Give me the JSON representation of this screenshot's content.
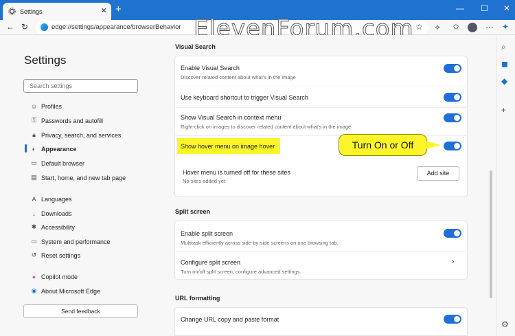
{
  "browser": {
    "tab_title": "Settings",
    "url": "edge://settings/appearance/browserBehavior",
    "watermark": "ElevenForum.com"
  },
  "nav": {
    "title": "Settings",
    "search_placeholder": "Search settings",
    "items": [
      {
        "label": "Profiles",
        "icon": "profile-icon"
      },
      {
        "label": "Passwords and autofill",
        "icon": "key-icon"
      },
      {
        "label": "Privacy, search, and services",
        "icon": "lock-icon"
      },
      {
        "label": "Appearance",
        "icon": "appearance-icon",
        "active": true
      },
      {
        "label": "Default browser",
        "icon": "browser-icon"
      },
      {
        "label": "Start, home, and new tab page",
        "icon": "home-icon"
      },
      {
        "label": "Languages",
        "icon": "language-icon"
      },
      {
        "label": "Downloads",
        "icon": "download-icon"
      },
      {
        "label": "Accessibility",
        "icon": "accessibility-icon"
      },
      {
        "label": "System and performance",
        "icon": "system-icon"
      },
      {
        "label": "Reset settings",
        "icon": "reset-icon"
      },
      {
        "label": "Copilot mode",
        "icon": "copilot-icon"
      },
      {
        "label": "About Microsoft Edge",
        "icon": "edge-icon"
      }
    ],
    "feedback": "Send feedback"
  },
  "visual_search": {
    "title": "Visual Search",
    "enable_title": "Enable Visual Search",
    "enable_sub": "Discover related content about what's in the image",
    "shortcut_title": "Use keyboard shortcut to trigger Visual Search",
    "context_title": "Show Visual Search in context menu",
    "context_sub": "Right-click on images to discover related content about what's in the image",
    "hover_title": "Show hover menu on image hover",
    "hover_off_title": "Hover menu is turned off for these sites",
    "hover_off_sub": "No sites added yet",
    "add_site": "Add site"
  },
  "split_screen": {
    "title": "Split screen",
    "enable_title": "Enable split screen",
    "enable_sub": "Multitask efficiently across side-by-side screens on one browsing tab.",
    "configure_title": "Configure split screen",
    "configure_sub": "Turn on/off split screen, configure advanced settings."
  },
  "url_formatting": {
    "title": "URL formatting",
    "change_title": "Change URL copy and paste format"
  },
  "callout": "Turn On or Off"
}
